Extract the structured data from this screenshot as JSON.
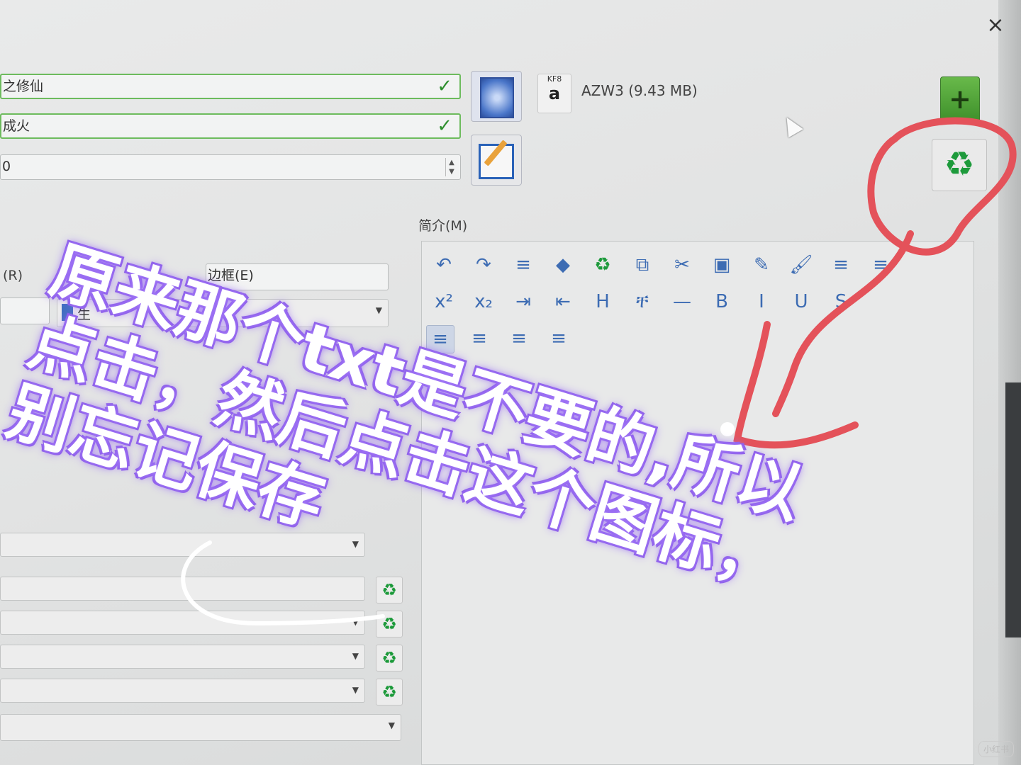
{
  "window": {
    "close_glyph": "×"
  },
  "metadata": {
    "title_value": "之修仙",
    "author_value": "成火",
    "series_value": "0"
  },
  "format": {
    "icon_top": "KF8",
    "icon_letter": "a",
    "label": "AZW3 (9.43 MB)"
  },
  "buttons": {
    "add_glyph": "+",
    "remove_glyph": "♻"
  },
  "left_panel": {
    "r_label": "(R)",
    "border_label": "边框(E)",
    "name_fragment": "生"
  },
  "description": {
    "label": "简介(M)",
    "toolbar_row1": [
      "↶",
      "↷",
      "≡",
      "◆",
      "♻",
      "⧉",
      "✂",
      "▣",
      "✎",
      "🖌",
      "≡",
      "≡"
    ],
    "toolbar_row2": [
      "x²",
      "x₂",
      "⇥",
      "⇤",
      "H",
      "ቸ",
      "—",
      "B",
      "I",
      "U",
      "S"
    ],
    "toolbar_row3": [
      "≡",
      "≡",
      "≡",
      "≡"
    ]
  },
  "overlay": {
    "text": "原来那个txt是不要的,所以点击，然后点击这个图标，别忘记保存"
  },
  "watermark": "小红书",
  "colors": {
    "accent_green": "#1d9a3b",
    "overlay_purple": "#8d5ee8",
    "annotation_red": "#e4525a"
  }
}
